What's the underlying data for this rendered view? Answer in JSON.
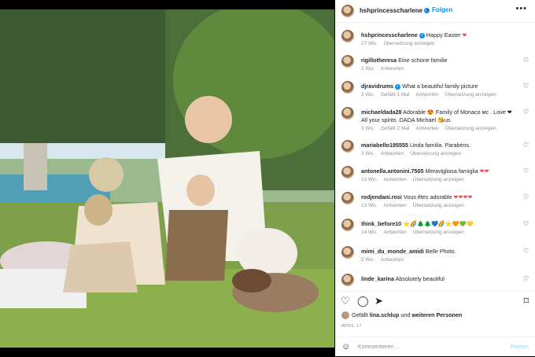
{
  "post": {
    "username": "hshprincesscharlene",
    "follow_label": "Folgen",
    "more_label": "•••"
  },
  "comments": [
    {
      "user": "hshprincesscharlene",
      "text": "Happy Easter",
      "emoji": "❤",
      "time": "27 Wo.",
      "actions": [
        "Übersetzung anzeigen"
      ],
      "verified": true
    },
    {
      "user": "rigillotheresa",
      "text": "Eine schone familie",
      "emoji": "",
      "time": "2 Wo.",
      "actions": [
        "Antworten"
      ]
    },
    {
      "user": "djravidrums",
      "text": "What a beautiful family picture",
      "emoji": "",
      "time": "3 Wo.",
      "actions": [
        "Gefällt 1 Mal",
        "Antworten",
        "Übersetzung anzeigen"
      ],
      "verified": true
    },
    {
      "user": "michaeldada28",
      "text": "Adorable 😍 Family of Monaco мс . Love ❤ All your spirits .DADA Michael 😘us",
      "emoji": "",
      "time": "3 Wo.",
      "actions": [
        "Gefällt 2 Mal",
        "Antworten",
        "Übersetzung anzeigen"
      ]
    },
    {
      "user": "mariabello195555",
      "text": "Linda familia. Parabéns.",
      "emoji": "",
      "time": "3 Wo.",
      "actions": [
        "Antworten",
        "Übersetzung anzeigen"
      ]
    },
    {
      "user": "antonella.antonini.7505",
      "text": "Meravigliosa famiglia",
      "emoji": "❤❤",
      "time": "13 Wo.",
      "actions": [
        "Antworten",
        "Übersetzung anzeigen"
      ]
    },
    {
      "user": "rodjendani.rosi",
      "text": "Vous êtes adorable",
      "emoji": "❤❤❤❤",
      "time": "13 Wo.",
      "actions": [
        "Antworten",
        "Übersetzung anzeigen"
      ]
    },
    {
      "user": "think_before10",
      "text": "⭐🌈🌲🌲💙🌈⭐🧡💚💛",
      "emoji": "",
      "time": "14 Wo.",
      "actions": [
        "Antworten",
        "Übersetzung anzeigen"
      ]
    },
    {
      "user": "mimi_du_monde_amidi",
      "text": "Belle Photo.",
      "emoji": "",
      "time": "5 Wo.",
      "actions": [
        "Antworten"
      ]
    },
    {
      "user": "linde_karina",
      "text": "Absolutely beautiful",
      "emoji": "",
      "time": "",
      "actions": []
    }
  ],
  "icons": [
    "heart-icon",
    "comment-icon",
    "share-icon",
    "bookmark-icon",
    "emoji-icon"
  ],
  "likes": {
    "prefix": "Gefällt",
    "user": "lina.schlup",
    "mid": "und",
    "rest": "weiteren Personen"
  },
  "date": "APRIL 17",
  "input": {
    "placeholder": "Kommentieren ...",
    "post_label": "Posten"
  },
  "colors": {
    "accent": "#0095f6",
    "muted": "#8e8e8e",
    "heart": "#ed4956"
  }
}
